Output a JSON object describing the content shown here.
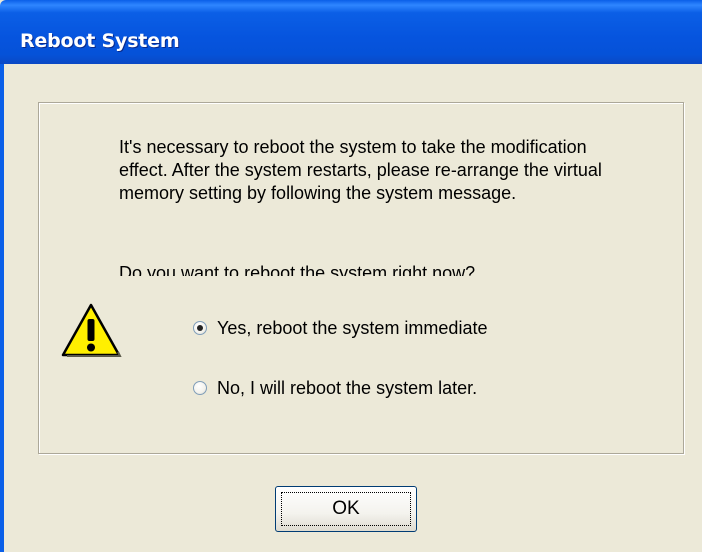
{
  "window": {
    "title": "Reboot System"
  },
  "message": {
    "body": "It's necessary to reboot the system to take the modification effect.  After the system restarts, please re-arrange the virtual memory setting by following the system message.",
    "question": "Do you want to reboot the system right now?"
  },
  "options": [
    {
      "label": "Yes, reboot the system immediate",
      "selected": true
    },
    {
      "label": "No, I will reboot the system later.",
      "selected": false
    }
  ],
  "buttons": {
    "ok_label": "OK"
  },
  "icons": {
    "warning": "warning-icon"
  },
  "colors": {
    "title_bar": "#0654de",
    "dialog_bg": "#ece9d8",
    "warning_yellow": "#ffef00"
  }
}
